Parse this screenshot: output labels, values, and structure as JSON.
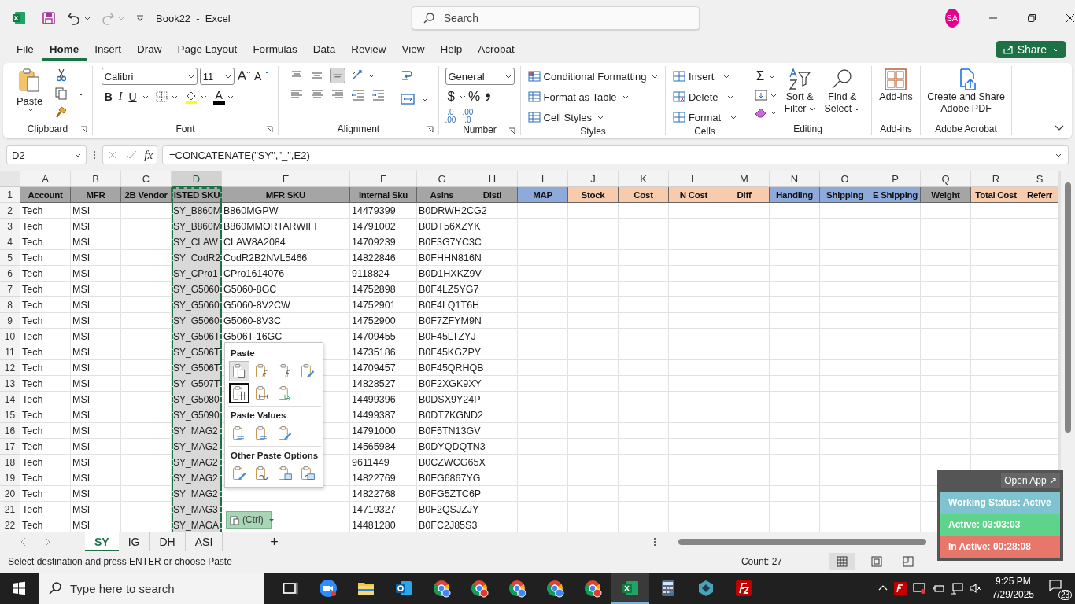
{
  "title_bar": {
    "title": "Book22  -  Excel",
    "search": {
      "placeholder": "Search"
    },
    "avatar": "SA"
  },
  "menu_tabs": [
    {
      "label": "File",
      "selected": false
    },
    {
      "label": "Home",
      "selected": true
    },
    {
      "label": "Insert",
      "selected": false
    },
    {
      "label": "Draw",
      "selected": false
    },
    {
      "label": "Page Layout",
      "selected": false
    },
    {
      "label": "Formulas",
      "selected": false
    },
    {
      "label": "Data",
      "selected": false
    },
    {
      "label": "Review",
      "selected": false
    },
    {
      "label": "View",
      "selected": false
    },
    {
      "label": "Help",
      "selected": false
    },
    {
      "label": "Acrobat",
      "selected": false
    }
  ],
  "share_button": "Share",
  "ribbon": {
    "paste": "Paste",
    "font_name": "Calibri",
    "font_size": "11",
    "grow_font": "A",
    "shrink_font": "A",
    "style_buttons": [
      "B",
      "I",
      "U"
    ],
    "font_color": "A",
    "number_format": "General",
    "currency": "$",
    "percent": "%",
    "decimals": [
      [
        ".0",
        ".00"
      ],
      [
        ".00",
        ".0"
      ]
    ],
    "styles": [
      "Conditional Formatting",
      "Format as Table",
      "Cell Styles"
    ],
    "cells": [
      "Insert",
      "Delete",
      "Format"
    ],
    "autosum": "Σ",
    "sort_filter": [
      "Sort &",
      "Filter"
    ],
    "find_select": [
      "Find &",
      "Select"
    ],
    "addins": "Add-ins",
    "acrobat": [
      "Create and Share",
      "Adobe PDF"
    ],
    "groups": [
      "Clipboard",
      "Font",
      "Alignment",
      "Number",
      "Styles",
      "Cells",
      "Editing",
      "Add-ins",
      "Adobe Acrobat"
    ]
  },
  "formula_bar": {
    "name_box": "D2",
    "fx": "fx",
    "formula": "=CONCATENATE(\"SY\",\"_\",E2)"
  },
  "columns": [
    {
      "letter": "A",
      "selected": false,
      "title": "Account",
      "color": "#a5a5a5"
    },
    {
      "letter": "B",
      "selected": false,
      "title": "MFR",
      "color": "#a5a5a5"
    },
    {
      "letter": "C",
      "selected": false,
      "title": "2B Vendor",
      "color": "#a5a5a5"
    },
    {
      "letter": "D",
      "selected": true,
      "title": "ISTED SKU",
      "color": "#a5a5a5"
    },
    {
      "letter": "E",
      "selected": false,
      "title": "MFR SKU",
      "color": "#a5a5a5"
    },
    {
      "letter": "F",
      "selected": false,
      "title": "Internal Sku",
      "color": "#a5a5a5"
    },
    {
      "letter": "G",
      "selected": false,
      "title": "Asins",
      "color": "#a5a5a5"
    },
    {
      "letter": "H",
      "selected": false,
      "title": "Disti",
      "color": "#a5a5a5"
    },
    {
      "letter": "I",
      "selected": false,
      "title": "MAP",
      "color": "#8eaadb"
    },
    {
      "letter": "J",
      "selected": false,
      "title": "Stock",
      "color": "#f8cbad"
    },
    {
      "letter": "K",
      "selected": false,
      "title": "Cost",
      "color": "#f8cbad"
    },
    {
      "letter": "L",
      "selected": false,
      "title": "N Cost",
      "color": "#f8cbad"
    },
    {
      "letter": "M",
      "selected": false,
      "title": "Diff",
      "color": "#f8cbad"
    },
    {
      "letter": "N",
      "selected": false,
      "title": "Handling",
      "color": "#8eaadb"
    },
    {
      "letter": "O",
      "selected": false,
      "title": "Shipping",
      "color": "#8eaadb"
    },
    {
      "letter": "P",
      "selected": false,
      "title": "E Shipping",
      "color": "#8eaadb"
    },
    {
      "letter": "Q",
      "selected": false,
      "title": "Weight",
      "color": "#a5a5a5"
    },
    {
      "letter": "R",
      "selected": false,
      "title": "Total Cost",
      "color": "#f8cbad"
    },
    {
      "letter": "S",
      "selected": false,
      "title": "Referr",
      "color": "#f8cbad"
    }
  ],
  "header_row_number": "1",
  "rows": [
    {
      "number": "2",
      "account": "Tech",
      "mfr": "MSI",
      "listed_sku": "SY_B860M",
      "mfr_sku": "B860MGPW",
      "internal_sku": "14479399",
      "asin": "B0DRWH2CG2"
    },
    {
      "number": "3",
      "account": "Tech",
      "mfr": "MSI",
      "listed_sku": "SY_B860M",
      "mfr_sku": "B860MMORTARWIFI",
      "internal_sku": "14791002",
      "asin": "B0DT56XZYK"
    },
    {
      "number": "4",
      "account": "Tech",
      "mfr": "MSI",
      "listed_sku": "SY_CLAW",
      "mfr_sku": "CLAW8A2084",
      "internal_sku": "14709239",
      "asin": "B0F3G7YC3C"
    },
    {
      "number": "5",
      "account": "Tech",
      "mfr": "MSI",
      "listed_sku": "SY_CodR2",
      "mfr_sku": "CodR2B2NVL5466",
      "internal_sku": "14822846",
      "asin": "B0FHHN816N"
    },
    {
      "number": "6",
      "account": "Tech",
      "mfr": "MSI",
      "listed_sku": "SY_CPro1",
      "mfr_sku": "CPro1614076",
      "internal_sku": "9118824",
      "asin": "B0D1HXKZ9V"
    },
    {
      "number": "7",
      "account": "Tech",
      "mfr": "MSI",
      "listed_sku": "SY_G5060",
      "mfr_sku": "G5060-8GC",
      "internal_sku": "14752898",
      "asin": "B0F4LZ5YG7"
    },
    {
      "number": "8",
      "account": "Tech",
      "mfr": "MSI",
      "listed_sku": "SY_G5060",
      "mfr_sku": "G5060-8V2CW",
      "internal_sku": "14752901",
      "asin": "B0F4LQ1T6H"
    },
    {
      "number": "9",
      "account": "Tech",
      "mfr": "MSI",
      "listed_sku": "SY_G5060",
      "mfr_sku": "G5060-8V3C",
      "internal_sku": "14752900",
      "asin": "B0F7ZFYM9N"
    },
    {
      "number": "10",
      "account": "Tech",
      "mfr": "MSI",
      "listed_sku": "SY_G506T",
      "mfr_sku": "G506T-16GC",
      "internal_sku": "14709455",
      "asin": "B0F45LTZYJ"
    },
    {
      "number": "11",
      "account": "Tech",
      "mfr": "MSI",
      "listed_sku": "SY_G506T",
      "internal_sku": "14735186",
      "asin": "B0F45KGZPY"
    },
    {
      "number": "12",
      "account": "Tech",
      "mfr": "MSI",
      "listed_sku": "SY_G506T",
      "internal_sku": "14709457",
      "asin": "B0F45QRHQB"
    },
    {
      "number": "13",
      "account": "Tech",
      "mfr": "MSI",
      "listed_sku": "SY_G507T",
      "internal_sku": "14828527",
      "asin": "B0F2XGK9XY"
    },
    {
      "number": "14",
      "account": "Tech",
      "mfr": "MSI",
      "listed_sku": "SY_G5080",
      "internal_sku": "14499396",
      "asin": "B0DSX9Y24P"
    },
    {
      "number": "15",
      "account": "Tech",
      "mfr": "MSI",
      "listed_sku": "SY_G5090",
      "internal_sku": "14499387",
      "asin": "B0DT7KGND2"
    },
    {
      "number": "16",
      "account": "Tech",
      "mfr": "MSI",
      "listed_sku": "SY_MAG2",
      "internal_sku": "14791000",
      "asin": "B0F5TN13GV"
    },
    {
      "number": "17",
      "account": "Tech",
      "mfr": "MSI",
      "listed_sku": "SY_MAG2",
      "internal_sku": "14565984",
      "asin": "B0DYQDQTN3"
    },
    {
      "number": "18",
      "account": "Tech",
      "mfr": "MSI",
      "listed_sku": "SY_MAG2",
      "internal_sku": "9611449",
      "asin": "B0CZWCG65X"
    },
    {
      "number": "19",
      "account": "Tech",
      "mfr": "MSI",
      "listed_sku": "SY_MAG2",
      "internal_sku": "14822769",
      "asin": "B0FG6867YG"
    },
    {
      "number": "20",
      "account": "Tech",
      "mfr": "MSI",
      "listed_sku": "SY_MAG2",
      "internal_sku": "14822768",
      "asin": "B0FG5ZTC6P"
    },
    {
      "number": "21",
      "account": "Tech",
      "mfr": "MSI",
      "listed_sku": "SY_MAG3",
      "internal_sku": "14719327",
      "asin": "B0F2QSJZJY"
    },
    {
      "number": "22",
      "account": "Tech",
      "mfr": "MSI",
      "listed_sku": "SY_MAGA",
      "internal_sku": "14481280",
      "asin": "B0FC2J85S3"
    }
  ],
  "paste_menu": {
    "sections": [
      {
        "title": "Paste",
        "options": [
          {
            "kind": "paste",
            "selected": false
          },
          {
            "kind": "formulas",
            "selected": false
          },
          {
            "kind": "formulas-format",
            "selected": false
          },
          {
            "kind": "keep-format",
            "selected": false
          },
          {
            "kind": "borders",
            "selected": true
          },
          {
            "kind": "widths",
            "selected": false
          },
          {
            "kind": "transpose",
            "selected": false
          }
        ]
      },
      {
        "title": "Paste Values",
        "options": [
          {
            "kind": "values",
            "selected": false
          },
          {
            "kind": "values-format",
            "selected": false
          },
          {
            "kind": "values-source",
            "selected": false
          }
        ]
      },
      {
        "title": "Other Paste Options",
        "options": [
          {
            "kind": "formatting",
            "selected": false
          },
          {
            "kind": "link",
            "selected": false
          },
          {
            "kind": "picture",
            "selected": false
          },
          {
            "kind": "linked-picture",
            "selected": false
          }
        ]
      }
    ],
    "ctrl_button": "(Ctrl)"
  },
  "sheet_tabs": [
    {
      "label": "SY",
      "selected": true
    },
    {
      "label": "IG",
      "selected": false
    },
    {
      "label": "DH",
      "selected": false
    },
    {
      "label": "ASI",
      "selected": false
    }
  ],
  "add_sheet": "+",
  "status_bar": {
    "message": "Select destination and press ENTER or choose Paste",
    "count": "Count: 27"
  },
  "tracker": {
    "open_app": "Open App ↗",
    "status": "Working Status: Active",
    "active": "Active: 03:03:03",
    "inactive": "In Active: 00:28:08"
  },
  "taskbar": {
    "search_placeholder": "Type here to search",
    "time": "9:25 PM",
    "date": "7/29/2025",
    "notifications": "23"
  }
}
